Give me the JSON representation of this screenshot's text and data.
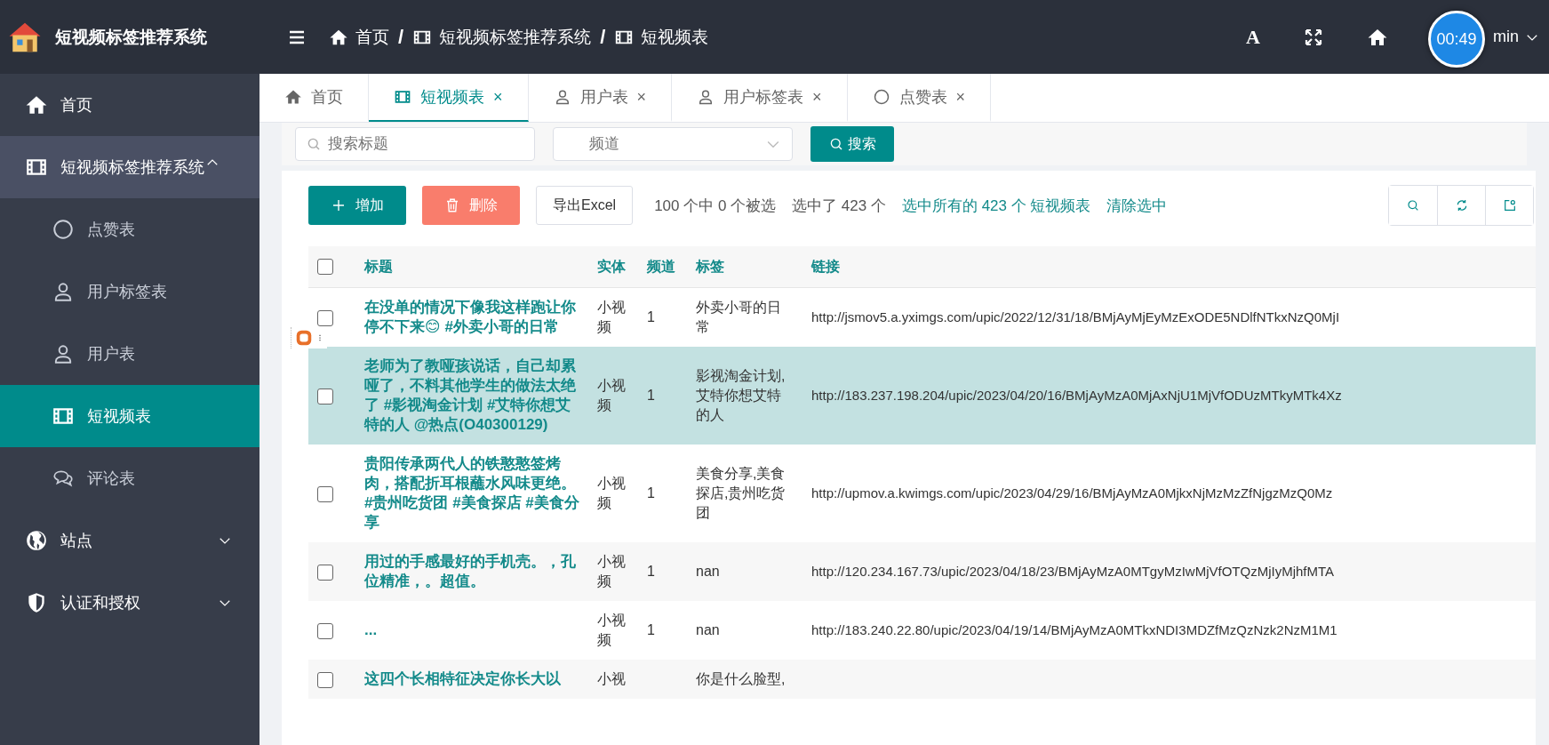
{
  "brand": {
    "title": "短视频标签推荐系统"
  },
  "header": {
    "breadcrumb": [
      "首页",
      "短视频标签推荐系统",
      "短视频表"
    ],
    "separators": [
      "/",
      "/"
    ],
    "font_button": "A",
    "user": "min",
    "timer": "00:49"
  },
  "sidebar": {
    "items": [
      {
        "label": "首页",
        "selected": false
      },
      {
        "label": "短视频标签推荐系统",
        "selected": false,
        "expanded": true,
        "children": [
          {
            "label": "点赞表",
            "selected": false
          },
          {
            "label": "用户标签表",
            "selected": false
          },
          {
            "label": "用户表",
            "selected": false
          },
          {
            "label": "短视频表",
            "selected": true
          },
          {
            "label": "评论表",
            "selected": false
          }
        ]
      },
      {
        "label": "站点",
        "selected": false,
        "expanded": false
      },
      {
        "label": "认证和授权",
        "selected": false,
        "expanded": false
      }
    ]
  },
  "tabs": [
    {
      "label": "首页",
      "selected": false
    },
    {
      "label": "短视频表",
      "selected": true,
      "close": "×"
    },
    {
      "label": "用户表",
      "selected": false,
      "close": "×"
    },
    {
      "label": "用户标签表",
      "selected": false,
      "close": "×"
    },
    {
      "label": "点赞表",
      "selected": false,
      "close": "×"
    }
  ],
  "filter": {
    "search_placeholder": "搜索标题",
    "channel_placeholder": "频道",
    "search_button": "搜索"
  },
  "toolbar": {
    "add": "增加",
    "delete": "删除",
    "export": "导出Excel",
    "selection_info": "100 个中 0 个被选",
    "selected_total": "选中了 423 个",
    "select_all_link": "选中所有的 423 个 短视频表",
    "clear_link": "清除选中"
  },
  "table": {
    "all_checked": false,
    "columns": [
      "标题",
      "实体",
      "频道",
      "标签",
      "链接"
    ],
    "rows": [
      {
        "checked": false,
        "selected": false,
        "title": "在没单的情况下像我这样跑让你停不下来😊 #外卖小哥的日常",
        "entity": "小视频",
        "channel": "1",
        "tags": "外卖小哥的日常",
        "link": "http://jsmov5.a.yximgs.com/upic/2022/12/31/18/BMjAyMjEyMzExODE5NDlfNTkxNzQ0MjI"
      },
      {
        "checked": false,
        "selected": true,
        "title": "老师为了教哑孩说话，自己却累哑了，不料其他学生的做法太绝了 #影视淘金计划 #艾特你想艾特的人 @热点(O40300129)",
        "entity": "小视频",
        "channel": "1",
        "tags": "影视淘金计划,艾特你想艾特的人",
        "link": "http://183.237.198.204/upic/2023/04/20/16/BMjAyMzA0MjAxNjU1MjVfODUzMTkyMTk4Xz"
      },
      {
        "checked": false,
        "selected": false,
        "title": "贵阳传承两代人的铁憨憨签烤肉，搭配折耳根蘸水风味更绝。 #贵州吃货团 #美食探店 #美食分享",
        "entity": "小视频",
        "channel": "1",
        "tags": "美食分享,美食探店,贵州吃货团",
        "link": "http://upmov.a.kwimgs.com/upic/2023/04/29/16/BMjAyMzA0MjkxNjMzMzZfNjgzMzQ0Mz"
      },
      {
        "checked": false,
        "selected": false,
        "title": "用过的手感最好的手机壳。，孔位精准，。超值。",
        "entity": "小视频",
        "channel": "1",
        "tags": "nan",
        "link": "http://120.234.167.73/upic/2023/04/18/23/BMjAyMzA0MTgyMzIwMjVfOTQzMjIyMjhfMTA"
      },
      {
        "checked": false,
        "selected": false,
        "title": "...",
        "entity": "小视频",
        "channel": "1",
        "tags": "nan",
        "link": "http://183.240.22.80/upic/2023/04/19/14/BMjAyMzA0MTkxNDI3MDZfMzQzNzk2NzM1M1"
      },
      {
        "checked": false,
        "selected": false,
        "title": "这四个长相特征决定你长大以",
        "entity": "小视",
        "tags": "你是什么脸型,"
      }
    ]
  }
}
